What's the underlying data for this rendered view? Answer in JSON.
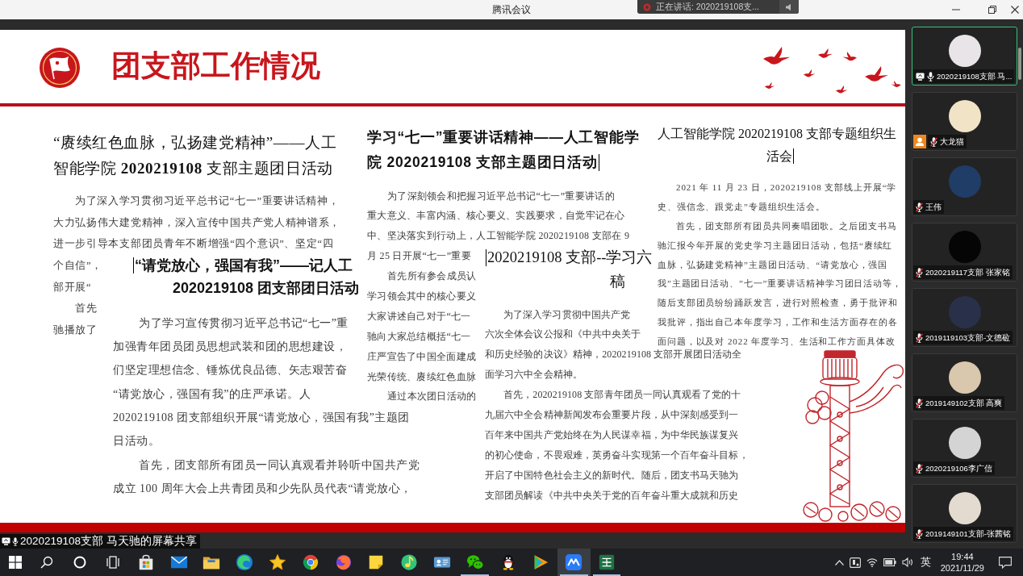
{
  "window": {
    "title": "腾讯会议"
  },
  "speaking_banner": {
    "text": "正在讲话: 2020219108支..."
  },
  "slide": {
    "title": "团支部工作情况",
    "documents": [
      {
        "title_lines": [
          "“赓续红色血脉，弘扬建党精神”——人工",
          "智能学院 **2020219108** 支部主题团日活动"
        ],
        "cursor_before_title": false,
        "cursor_after_title": false,
        "paragraphs": [
          [
            "为了深入学习贯彻习近平总书记“七一”重要讲话精神，",
            "大力弘扬伟大建党精神，深入宣传中国共产党人精神谱系，",
            "进一步引导本支部团员青年不断增强“四个意识”、坚定“四",
            "个自信”，",
            "部开展“"
          ],
          [
            "首先",
            "驰播放了"
          ]
        ]
      },
      {
        "title_lines": [
          "“请党放心，强国有我”——记人工",
          "2020219108 团支部团日活动"
        ],
        "cursor_before_title": true,
        "cursor_after_title": false,
        "paragraphs": [
          [
            "为了学习宣传贯彻习近平总书记“七一”重",
            "加强青年团员团员思想武装和团的思想建设，",
            "们坚定理想信念、锤炼优良品德、矢志艰苦奋",
            "“请党放心，强国有我”的庄严承诺。人",
            "2020219108 团支部组织开展“请党放心，强国有我”主题团",
            "日活动。"
          ],
          [
            "首先，团支部所有团员一同认真观看并聆听中国共产党",
            "成立 100 周年大会上共青团员和少先队员代表“请党放心，"
          ]
        ]
      },
      {
        "title_lines": [
          "学习“七一”重要讲话精神——人工智能学",
          "院 2020219108 支部主题团日活动"
        ],
        "cursor_before_title": false,
        "cursor_after_title": true,
        "paragraphs": [
          [
            "为了深刻领会和把握习近平总书记“七一”重要讲话的",
            "重大意义、丰富内涵、核心要义、实践要求，自觉牢记在心",
            "中、坚决落实到行动上，人工智能学院 2020219108 支部在 9",
            "月 25 日开展“七一”重要"
          ],
          [
            "首先所有参会成员认",
            "学习领会其中的核心要义",
            "大家讲述自己对于“七一",
            "驰向大家总结概括“七一",
            "庄严宣告了中国全面建成",
            "光荣传统、赓续红色血脉"
          ],
          [
            "通过本次团日活动的"
          ]
        ]
      },
      {
        "title_lines": [
          "2020219108 支部--学习六",
          "稿"
        ],
        "cursor_before_title": true,
        "cursor_after_title": false,
        "paragraphs": [
          [
            "为了深入学习贯彻中国共产党",
            "六次全体会议公报和《中共中央关于",
            "和历史经验的决议》精神，2020219108 支部开展团日活动全",
            "面学习六中全会精神。"
          ],
          [
            "首先，2020219108 支部青年团员一同认真观看了党的十",
            "九届六中全会精神新闻发布会重要片段，从中深刻感受到一",
            "百年来中国共产党始终在为人民谋幸福，为中华民族谋复兴",
            "的初心使命，不畏艰难，英勇奋斗实现第一个百年奋斗目标，",
            "开启了中国特色社会主义的新时代。随后，团支书马天驰为",
            "支部团员解读《中共中央关于党的百年奋斗重大成就和历史"
          ]
        ]
      },
      {
        "title_lines": [
          "人工智能学院 2020219108 支部专题组织生",
          "活会"
        ],
        "cursor_before_title": false,
        "cursor_after_title": true,
        "paragraphs": [
          [
            "2021 年 11 月 23 日，2020219108 支部线上开展“学",
            "史、强信念、跟党走”专题组织生活会。"
          ],
          [
            "首先，团支部所有团员共同奏唱团歌。之后团支书马",
            "驰汇报今年开展的党史学习主题团日活动，包括“赓续红",
            "血脉，弘扬建党精神”主题团日活动、“请党放心，强国",
            "我”主题团日活动、”七一”重要讲话精神学习团日活动等，",
            "随后支部团员纷纷踊跃发言，进行对照检查，勇于批评和",
            "我批评，指出自己本年度学习，工作和生活方面存在的各",
            "面问题，以及对 2022 年度学习、生活和工作方面具体改"
          ]
        ]
      }
    ]
  },
  "participants": [
    {
      "name": "2020219108支部 马...",
      "color": "#e8e4e8",
      "speaking": true,
      "sharing": true,
      "muted": false,
      "person_badge": false
    },
    {
      "name": "大龙猫",
      "color": "#f1e3c6",
      "speaking": false,
      "sharing": false,
      "muted": true,
      "person_badge": true
    },
    {
      "name": "王伟",
      "color": "#1f3d66",
      "speaking": false,
      "sharing": false,
      "muted": true,
      "person_badge": false
    },
    {
      "name": "2020219117支部 张家铭",
      "color": "#050505",
      "speaking": false,
      "sharing": false,
      "muted": true,
      "person_badge": false
    },
    {
      "name": "2019119103支部-文德砬",
      "color": "#29304a",
      "speaking": false,
      "sharing": false,
      "muted": true,
      "person_badge": false
    },
    {
      "name": "2019149102支部 高爽",
      "color": "#d9c7ae",
      "speaking": false,
      "sharing": false,
      "muted": true,
      "person_badge": false
    },
    {
      "name": "2020219106李广信",
      "color": "#d4d4d4",
      "speaking": false,
      "sharing": false,
      "muted": true,
      "person_badge": false
    },
    {
      "name": "2019149101支部-张茜铭",
      "color": "#e4dbd0",
      "speaking": false,
      "sharing": false,
      "muted": true,
      "person_badge": false
    }
  ],
  "share_indicator": {
    "text": "2020219108支部 马天驰的屏幕共享"
  },
  "taskbar": {
    "apps": [
      {
        "kind": "store",
        "running": false,
        "selected": false
      },
      {
        "kind": "mail",
        "running": false,
        "selected": false
      },
      {
        "kind": "folder",
        "running": false,
        "selected": false
      },
      {
        "kind": "swirl",
        "running": false,
        "selected": false
      },
      {
        "kind": "star",
        "running": false,
        "selected": false
      },
      {
        "kind": "wheel",
        "running": false,
        "selected": false
      },
      {
        "kind": "fox",
        "running": false,
        "selected": false
      },
      {
        "kind": "note",
        "running": false,
        "selected": false
      },
      {
        "kind": "disc",
        "running": false,
        "selected": false
      },
      {
        "kind": "card",
        "running": false,
        "selected": false
      },
      {
        "kind": "chat",
        "running": true,
        "selected": false
      },
      {
        "kind": "penguin",
        "running": false,
        "selected": false
      },
      {
        "kind": "play",
        "running": false,
        "selected": false
      },
      {
        "kind": "meeting",
        "running": true,
        "selected": true
      },
      {
        "kind": "sheet",
        "running": true,
        "selected": false
      }
    ],
    "input_method": "英",
    "time": "19:44",
    "date": "2021/11/29"
  }
}
